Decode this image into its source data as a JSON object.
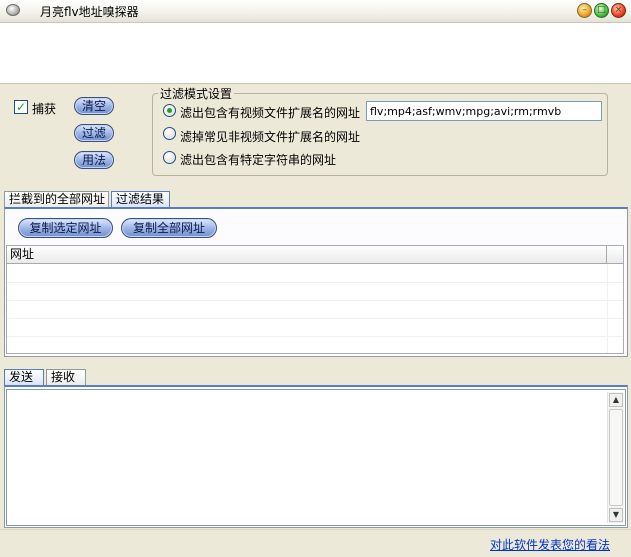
{
  "window": {
    "title": "月亮flv地址嗅探器"
  },
  "controls": {
    "capture_label": "捕获",
    "capture_checked": true,
    "clear_label": "清空",
    "filter_label": "过滤",
    "usage_label": "用法"
  },
  "filter_group": {
    "title": "过滤模式设置",
    "options": [
      {
        "label": "滤出包含有视频文件扩展名的网址",
        "selected": true
      },
      {
        "label": "滤掉常见非视频文件扩展名的网址",
        "selected": false
      },
      {
        "label": "滤出包含有特定字符串的网址",
        "selected": false
      }
    ],
    "extensions_value": "flv;mp4;asf;wmv;mpg;avi;rm;rmvb"
  },
  "tabs_top": [
    {
      "label": "拦截到的全部网址",
      "active": false
    },
    {
      "label": "过滤结果",
      "active": true
    }
  ],
  "results": {
    "copy_selected_label": "复制选定网址",
    "copy_all_label": "复制全部网址",
    "column_header": "网址",
    "rows": []
  },
  "tabs_bottom": [
    {
      "label": "发送",
      "active": true
    },
    {
      "label": "接收",
      "active": false
    }
  ],
  "send_text": "",
  "feedback_link": "对此软件发表您的看法",
  "colors": {
    "accent": "#5a7cc0",
    "check": "#21a121",
    "link": "#0033cc"
  }
}
